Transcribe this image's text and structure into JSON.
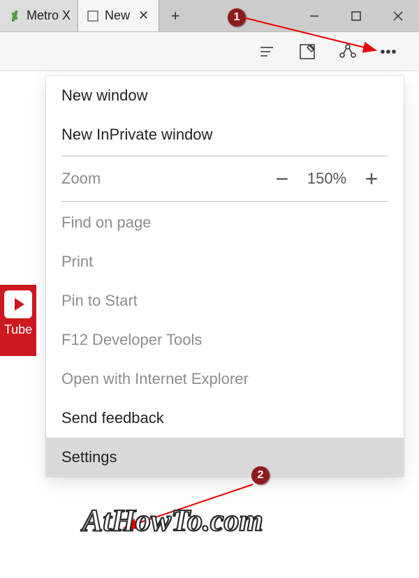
{
  "titlebar": {
    "tabs": [
      {
        "label": "Metro X",
        "favicon": "deviantart"
      },
      {
        "label": "New",
        "favicon": "page"
      }
    ]
  },
  "toolbar": {
    "icons": [
      "reading-list",
      "web-note",
      "share",
      "more"
    ]
  },
  "menu": {
    "new_window": "New window",
    "new_inprivate": "New InPrivate window",
    "zoom_label": "Zoom",
    "zoom_value": "150%",
    "find": "Find on page",
    "print": "Print",
    "pin": "Pin to Start",
    "devtools": "F12 Developer Tools",
    "open_ie": "Open with Internet Explorer",
    "feedback": "Send feedback",
    "settings": "Settings"
  },
  "sidebar": {
    "label": "Tube"
  },
  "callouts": {
    "b1": "1",
    "b2": "2"
  },
  "watermark": "AtHowTo.com"
}
